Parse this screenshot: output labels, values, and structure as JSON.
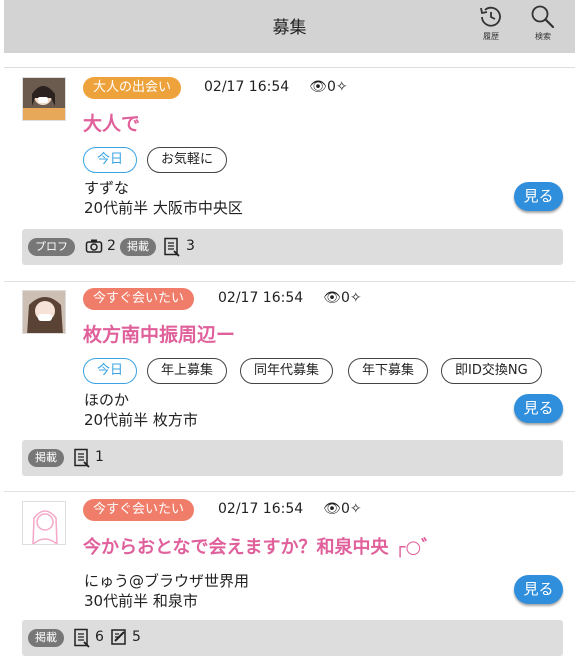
{
  "header": {
    "title": "募集",
    "history_label": "履歴",
    "search_label": "検索"
  },
  "posts": [
    {
      "category": "大人の出会い",
      "category_color": "#eea23b",
      "datetime": "02/17 16:54",
      "views": "0",
      "title": "大人で",
      "tags": [
        "今日",
        "お気軽に"
      ],
      "name": "すずな",
      "info": "20代前半 大阪市中央区",
      "see_label": "見る",
      "stats": {
        "profile_label": "プロフ",
        "photos": "2",
        "post_label": "掲載",
        "posts": "3"
      }
    },
    {
      "category": "今すぐ会いたい",
      "category_color": "#ef7d69",
      "datetime": "02/17 16:54",
      "views": "0",
      "title": "枚方南中振周辺ー",
      "tags": [
        "今日",
        "年上募集",
        "同年代募集",
        "年下募集",
        "即ID交換NG"
      ],
      "name": "ほのか",
      "info": "20代前半 枚方市",
      "see_label": "見る",
      "stats": {
        "post_label": "掲載",
        "posts": "1"
      }
    },
    {
      "category": "今すぐ会いたい",
      "category_color": "#ef7d69",
      "datetime": "02/17 16:54",
      "views": "0",
      "title": "今からおとなで会えますか？和泉中央 ┌○゛",
      "name": "にゅう@ブラウザ世界用",
      "info": "30代前半 和泉市",
      "see_label": "見る",
      "stats": {
        "post_label": "掲載",
        "posts": "6",
        "edits": "5"
      }
    }
  ]
}
